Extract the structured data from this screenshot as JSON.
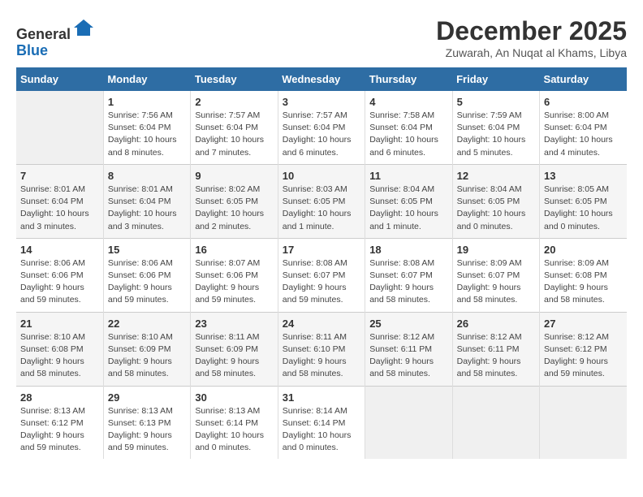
{
  "header": {
    "logo_general": "General",
    "logo_blue": "Blue",
    "month_title": "December 2025",
    "subtitle": "Zuwarah, An Nuqat al Khams, Libya"
  },
  "calendar": {
    "days_of_week": [
      "Sunday",
      "Monday",
      "Tuesday",
      "Wednesday",
      "Thursday",
      "Friday",
      "Saturday"
    ],
    "weeks": [
      [
        {
          "day": "",
          "info": ""
        },
        {
          "day": "1",
          "info": "Sunrise: 7:56 AM\nSunset: 6:04 PM\nDaylight: 10 hours\nand 8 minutes."
        },
        {
          "day": "2",
          "info": "Sunrise: 7:57 AM\nSunset: 6:04 PM\nDaylight: 10 hours\nand 7 minutes."
        },
        {
          "day": "3",
          "info": "Sunrise: 7:57 AM\nSunset: 6:04 PM\nDaylight: 10 hours\nand 6 minutes."
        },
        {
          "day": "4",
          "info": "Sunrise: 7:58 AM\nSunset: 6:04 PM\nDaylight: 10 hours\nand 6 minutes."
        },
        {
          "day": "5",
          "info": "Sunrise: 7:59 AM\nSunset: 6:04 PM\nDaylight: 10 hours\nand 5 minutes."
        },
        {
          "day": "6",
          "info": "Sunrise: 8:00 AM\nSunset: 6:04 PM\nDaylight: 10 hours\nand 4 minutes."
        }
      ],
      [
        {
          "day": "7",
          "info": "Sunrise: 8:01 AM\nSunset: 6:04 PM\nDaylight: 10 hours\nand 3 minutes."
        },
        {
          "day": "8",
          "info": "Sunrise: 8:01 AM\nSunset: 6:04 PM\nDaylight: 10 hours\nand 3 minutes."
        },
        {
          "day": "9",
          "info": "Sunrise: 8:02 AM\nSunset: 6:05 PM\nDaylight: 10 hours\nand 2 minutes."
        },
        {
          "day": "10",
          "info": "Sunrise: 8:03 AM\nSunset: 6:05 PM\nDaylight: 10 hours\nand 1 minute."
        },
        {
          "day": "11",
          "info": "Sunrise: 8:04 AM\nSunset: 6:05 PM\nDaylight: 10 hours\nand 1 minute."
        },
        {
          "day": "12",
          "info": "Sunrise: 8:04 AM\nSunset: 6:05 PM\nDaylight: 10 hours\nand 0 minutes."
        },
        {
          "day": "13",
          "info": "Sunrise: 8:05 AM\nSunset: 6:05 PM\nDaylight: 10 hours\nand 0 minutes."
        }
      ],
      [
        {
          "day": "14",
          "info": "Sunrise: 8:06 AM\nSunset: 6:06 PM\nDaylight: 9 hours\nand 59 minutes."
        },
        {
          "day": "15",
          "info": "Sunrise: 8:06 AM\nSunset: 6:06 PM\nDaylight: 9 hours\nand 59 minutes."
        },
        {
          "day": "16",
          "info": "Sunrise: 8:07 AM\nSunset: 6:06 PM\nDaylight: 9 hours\nand 59 minutes."
        },
        {
          "day": "17",
          "info": "Sunrise: 8:08 AM\nSunset: 6:07 PM\nDaylight: 9 hours\nand 59 minutes."
        },
        {
          "day": "18",
          "info": "Sunrise: 8:08 AM\nSunset: 6:07 PM\nDaylight: 9 hours\nand 58 minutes."
        },
        {
          "day": "19",
          "info": "Sunrise: 8:09 AM\nSunset: 6:07 PM\nDaylight: 9 hours\nand 58 minutes."
        },
        {
          "day": "20",
          "info": "Sunrise: 8:09 AM\nSunset: 6:08 PM\nDaylight: 9 hours\nand 58 minutes."
        }
      ],
      [
        {
          "day": "21",
          "info": "Sunrise: 8:10 AM\nSunset: 6:08 PM\nDaylight: 9 hours\nand 58 minutes."
        },
        {
          "day": "22",
          "info": "Sunrise: 8:10 AM\nSunset: 6:09 PM\nDaylight: 9 hours\nand 58 minutes."
        },
        {
          "day": "23",
          "info": "Sunrise: 8:11 AM\nSunset: 6:09 PM\nDaylight: 9 hours\nand 58 minutes."
        },
        {
          "day": "24",
          "info": "Sunrise: 8:11 AM\nSunset: 6:10 PM\nDaylight: 9 hours\nand 58 minutes."
        },
        {
          "day": "25",
          "info": "Sunrise: 8:12 AM\nSunset: 6:11 PM\nDaylight: 9 hours\nand 58 minutes."
        },
        {
          "day": "26",
          "info": "Sunrise: 8:12 AM\nSunset: 6:11 PM\nDaylight: 9 hours\nand 58 minutes."
        },
        {
          "day": "27",
          "info": "Sunrise: 8:12 AM\nSunset: 6:12 PM\nDaylight: 9 hours\nand 59 minutes."
        }
      ],
      [
        {
          "day": "28",
          "info": "Sunrise: 8:13 AM\nSunset: 6:12 PM\nDaylight: 9 hours\nand 59 minutes."
        },
        {
          "day": "29",
          "info": "Sunrise: 8:13 AM\nSunset: 6:13 PM\nDaylight: 9 hours\nand 59 minutes."
        },
        {
          "day": "30",
          "info": "Sunrise: 8:13 AM\nSunset: 6:14 PM\nDaylight: 10 hours\nand 0 minutes."
        },
        {
          "day": "31",
          "info": "Sunrise: 8:14 AM\nSunset: 6:14 PM\nDaylight: 10 hours\nand 0 minutes."
        },
        {
          "day": "",
          "info": ""
        },
        {
          "day": "",
          "info": ""
        },
        {
          "day": "",
          "info": ""
        }
      ]
    ]
  }
}
